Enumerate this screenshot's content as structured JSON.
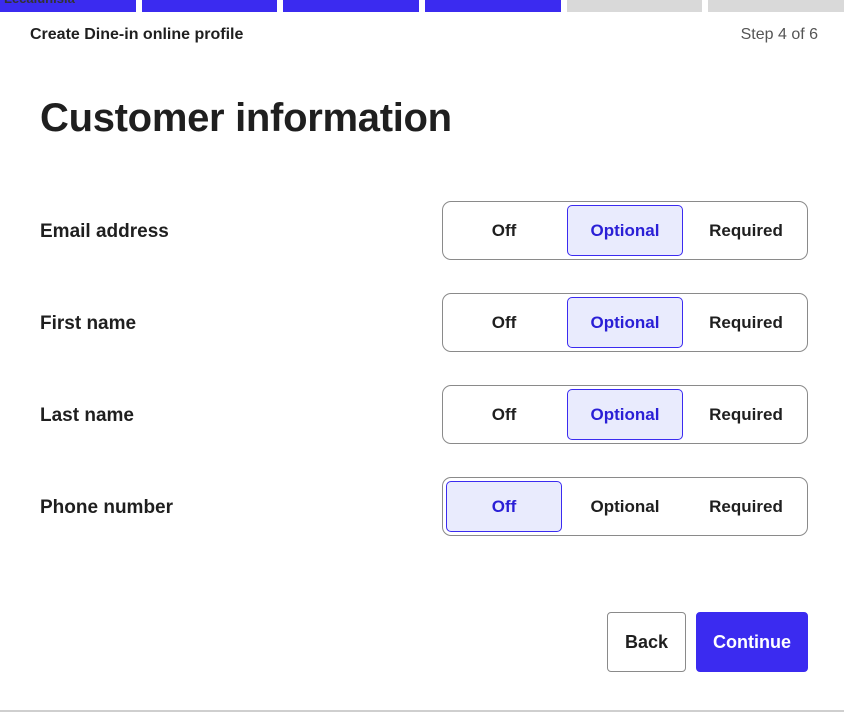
{
  "colors": {
    "accent": "#3b2bf0",
    "accent_text": "#2a1fd6",
    "progress_done": "#3b2bf0",
    "progress_todo": "#d9d9d9"
  },
  "progress": {
    "total_steps": 6,
    "completed_steps": 4,
    "overlay_text": "Lecalunisia"
  },
  "header": {
    "title": "Create Dine-in online profile",
    "step_label": "Step 4 of 6"
  },
  "main": {
    "title": "Customer information",
    "options": [
      "Off",
      "Optional",
      "Required"
    ],
    "fields": [
      {
        "label": "Email address",
        "selected": "Optional"
      },
      {
        "label": "First name",
        "selected": "Optional"
      },
      {
        "label": "Last name",
        "selected": "Optional"
      },
      {
        "label": "Phone number",
        "selected": "Off"
      }
    ]
  },
  "actions": {
    "back_label": "Back",
    "continue_label": "Continue"
  }
}
